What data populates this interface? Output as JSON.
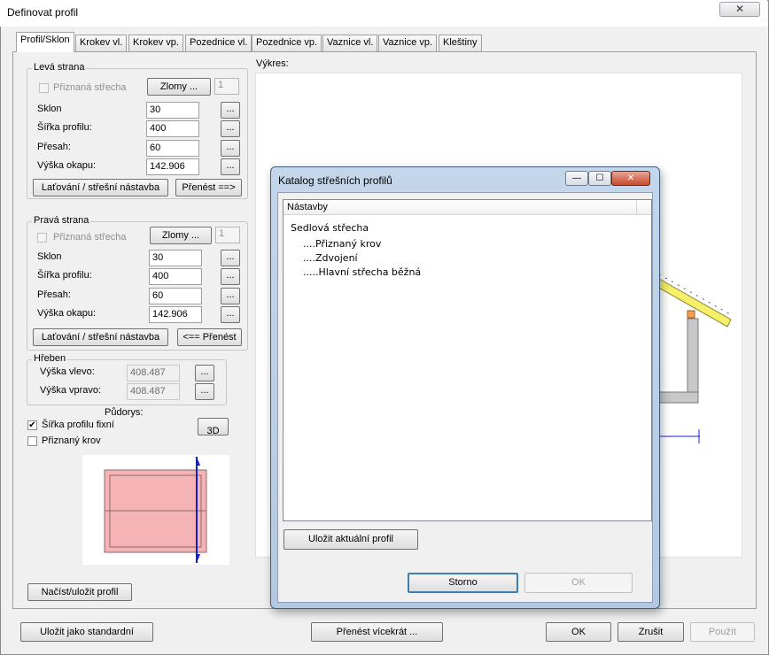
{
  "window": {
    "title": "Definovat profil",
    "close_glyph": "✕"
  },
  "tabs": [
    "Profil/Sklon",
    "Krokev vl.",
    "Krokev vp.",
    "Pozednice vl.",
    "Pozednice vp.",
    "Vaznice vl.",
    "Vaznice vp.",
    "Kleštiny"
  ],
  "left_side": {
    "legend": "Levá strana",
    "visible_roof_label": "Přiznaná střecha",
    "breaks_button": "Zlomy ...",
    "breaks_count": "1",
    "pitch_label": "Sklon",
    "pitch_value": "30",
    "width_label": "Šířka profilu:",
    "width_value": "400",
    "overhang_label": "Přesah:",
    "overhang_value": "60",
    "eaves_label": "Výška okapu:",
    "eaves_value": "142.906",
    "ellipsis": "...",
    "battens_button": "Laťování / střešní nástavba",
    "transfer_button": "Přenést ==>"
  },
  "right_side": {
    "legend": "Pravá strana",
    "visible_roof_label": "Přiznaná střecha",
    "breaks_button": "Zlomy ...",
    "breaks_count": "1",
    "pitch_label": "Sklon",
    "pitch_value": "30",
    "width_label": "Šířka profilu:",
    "width_value": "400",
    "overhang_label": "Přesah:",
    "overhang_value": "60",
    "eaves_label": "Výška okapu:",
    "eaves_value": "142.906",
    "ellipsis": "...",
    "battens_button": "Laťování / střešní nástavba",
    "transfer_button": "<== Přenést"
  },
  "ridge": {
    "legend": "Hřeben",
    "left_label": "Výška vlevo:",
    "left_value": "408.487",
    "right_label": "Výška vpravo:",
    "right_value": "408.487",
    "ellipsis": "..."
  },
  "plan": {
    "label": "Půdorys:",
    "fixed_width_label": "Šířka profilu fixní",
    "fixed_width_checked": true,
    "visible_truss_label": "Přiznaný krov",
    "visible_truss_checked": false,
    "button_3d": "3D"
  },
  "load_save_button": "Načíst/uložit profil",
  "drawing_label": "Výkres:",
  "catalog": {
    "title": "Katalog střešních profilů",
    "min_glyph": "—",
    "max_glyph": "☐",
    "close_glyph": "✕",
    "column_header": "Nástavby",
    "items": [
      "Sedlová střecha",
      "....Přiznaný krov",
      "....Zdvojení",
      ".....Hlavní střecha běžná"
    ],
    "save_button": "Uložit aktuální profil",
    "cancel_button": "Storno",
    "ok_button": "OK"
  },
  "footer": {
    "save_default": "Uložit jako standardní",
    "transfer_multi": "Přenést vícekrát ...",
    "ok": "OK",
    "cancel": "Zrušit",
    "apply": "Použít"
  },
  "colors": {
    "roof_yellow": "#f5ef6a",
    "plan_pink": "#f6b3b3",
    "marker_blue": "#1020d0",
    "wall_gray": "#c8c8c8"
  }
}
